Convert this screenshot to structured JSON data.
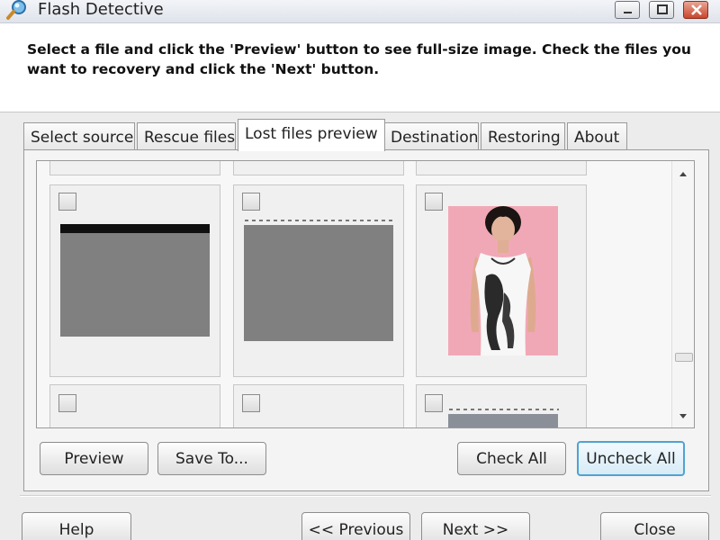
{
  "window": {
    "title": "Flash Detective",
    "controls": {
      "minimize": "minimize",
      "maximize": "maximize",
      "close": "close"
    }
  },
  "instruction": "Select a file and click the 'Preview' button to see full-size image. Check the files you want to recovery and click the 'Next' button.",
  "tabs": [
    {
      "label": "Select source",
      "active": false
    },
    {
      "label": "Rescue files",
      "active": false
    },
    {
      "label": "Lost files preview",
      "active": true
    },
    {
      "label": "Destination",
      "active": false
    },
    {
      "label": "Restoring",
      "active": false
    },
    {
      "label": "About",
      "active": false
    }
  ],
  "thumbnails": [
    {
      "checked": false,
      "content": "gray image"
    },
    {
      "checked": false,
      "content": "gray image"
    },
    {
      "checked": false,
      "content": "photo of woman"
    },
    {
      "checked": false,
      "content": "partial"
    },
    {
      "checked": false,
      "content": "partial"
    },
    {
      "checked": false,
      "content": "partial image"
    }
  ],
  "actions": {
    "preview": "Preview",
    "save_to": "Save To...",
    "check_all": "Check All",
    "uncheck_all": "Uncheck All"
  },
  "nav": {
    "help": "Help",
    "previous": "<< Previous",
    "next": "Next >>",
    "close": "Close"
  },
  "colors": {
    "accent_focus": "#4fa3d2",
    "close_button": "#c9462c",
    "photo_background": "#f0a7b4"
  }
}
